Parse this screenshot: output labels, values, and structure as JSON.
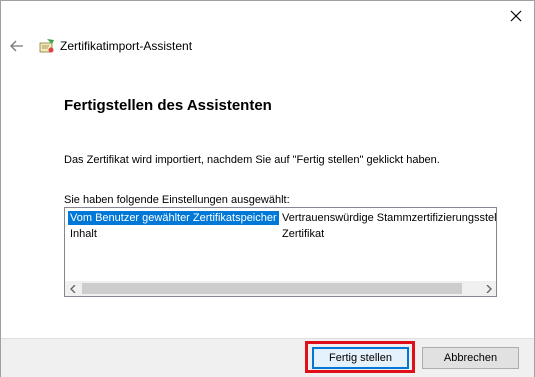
{
  "window": {
    "title": "Zertifikatimport-Assistent",
    "close_icon": "close-icon",
    "back_icon": "back-arrow-icon"
  },
  "main": {
    "heading": "Fertigstellen des Assistenten",
    "description": "Das Zertifikat wird importiert, nachdem Sie auf \"Fertig stellen\" geklickt haben.",
    "settings_label": "Sie haben folgende Einstellungen ausgewählt:",
    "settings": [
      {
        "key": "Vom Benutzer gewählter Zertifikatspeicher",
        "value": "Vertrauenswürdige Stammzertifizierungsstelle",
        "selected": true
      },
      {
        "key": "Inhalt",
        "value": "Zertifikat",
        "selected": false
      }
    ]
  },
  "footer": {
    "finish_label": "Fertig stellen",
    "cancel_label": "Abbrechen"
  },
  "colors": {
    "selection": "#0078d7",
    "highlight_box": "#e0101a"
  }
}
